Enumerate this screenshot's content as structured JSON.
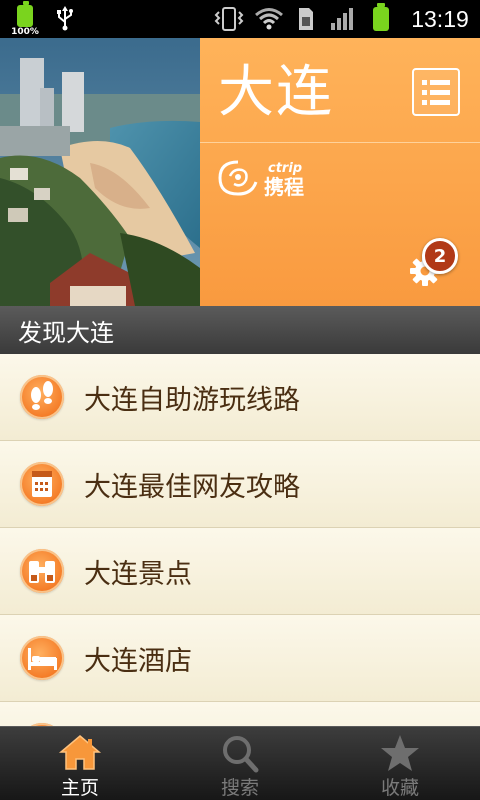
{
  "status_bar": {
    "battery_percent_left": "100%",
    "time": "13:19",
    "icons": [
      "battery-icon",
      "usb-icon",
      "vibrate-icon",
      "wifi-icon",
      "sim-icon",
      "signal-icon",
      "battery-icon"
    ]
  },
  "header": {
    "city_title": "大连",
    "brand": {
      "name_en": "ctrip",
      "name_cn": "携程"
    },
    "notification_count": "2",
    "colors": {
      "panel": "#f99a3f",
      "badge": "#b13917"
    }
  },
  "section": {
    "title": "发现大连"
  },
  "list_items": [
    {
      "label": "大连自助游玩线路",
      "icon": "footprints-icon"
    },
    {
      "label": "大连最佳网友攻略",
      "icon": "guidebook-icon"
    },
    {
      "label": "大连景点",
      "icon": "binoculars-icon"
    },
    {
      "label": "大连酒店",
      "icon": "bed-icon"
    },
    {
      "label": "",
      "icon": "food-icon"
    }
  ],
  "bottom_nav": {
    "tabs": [
      {
        "label": "主页",
        "icon": "home-icon",
        "active": true
      },
      {
        "label": "搜索",
        "icon": "search-icon",
        "active": false
      },
      {
        "label": "收藏",
        "icon": "star-icon",
        "active": false
      }
    ],
    "active_color": "#f7973a"
  }
}
